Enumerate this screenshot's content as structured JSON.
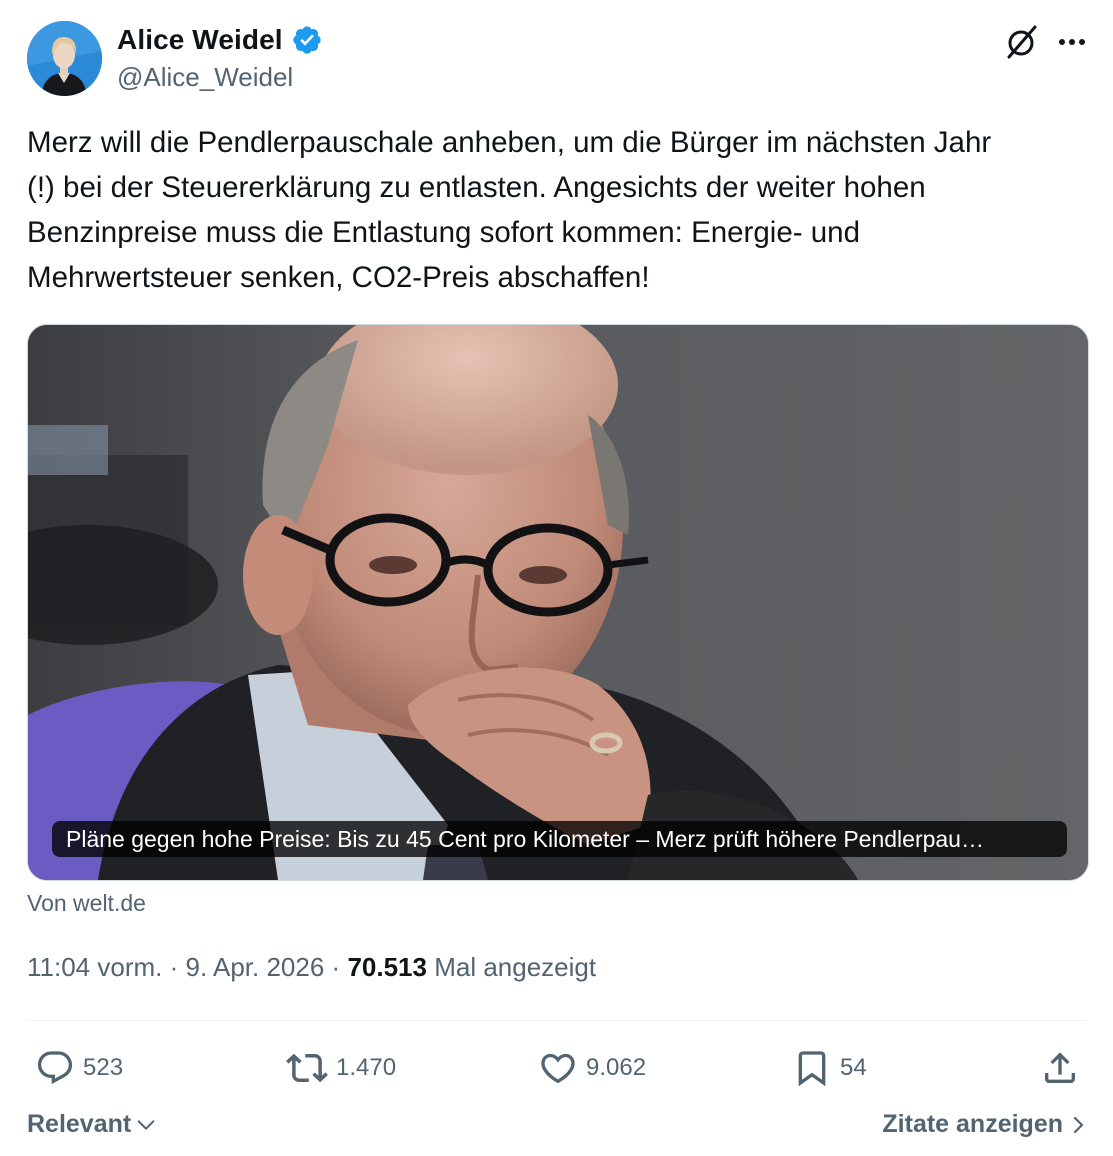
{
  "author": {
    "display_name": "Alice Weidel",
    "handle": "@Alice_Weidel",
    "verified": true
  },
  "header_icons": {
    "grok": "grok-icon",
    "more": "more-icon"
  },
  "tweet": {
    "text": "Merz will die Pendlerpauschale anheben, um die Bürger im nächsten Jahr\n(!) bei der Steuererklärung zu entlasten. Angesichts der weiter hohen\nBenzinpreise muss die Entlastung sofort kommen: Energie- und\nMehrwertsteuer senken, CO2-Preis abschaffen!"
  },
  "link_card": {
    "caption": "Pläne gegen hohe Preise: Bis zu 45 Cent pro Kilometer – Merz prüft höhere Pendlerpau…",
    "source": "Von welt.de"
  },
  "meta": {
    "time": "11:04 vorm.",
    "separator": "·",
    "date": "9. Apr. 2026",
    "views_count": "70.513",
    "views_label": "Mal angezeigt"
  },
  "actions": {
    "replies": "523",
    "reposts": "1.470",
    "likes": "9.062",
    "bookmarks": "54"
  },
  "footer": {
    "sort_label": "Relevant",
    "quotes_label": "Zitate anzeigen"
  },
  "colors": {
    "text_primary": "#0f1419",
    "text_secondary": "#536471",
    "verified_blue": "#1d9bf0",
    "divider": "#eff3f4"
  }
}
